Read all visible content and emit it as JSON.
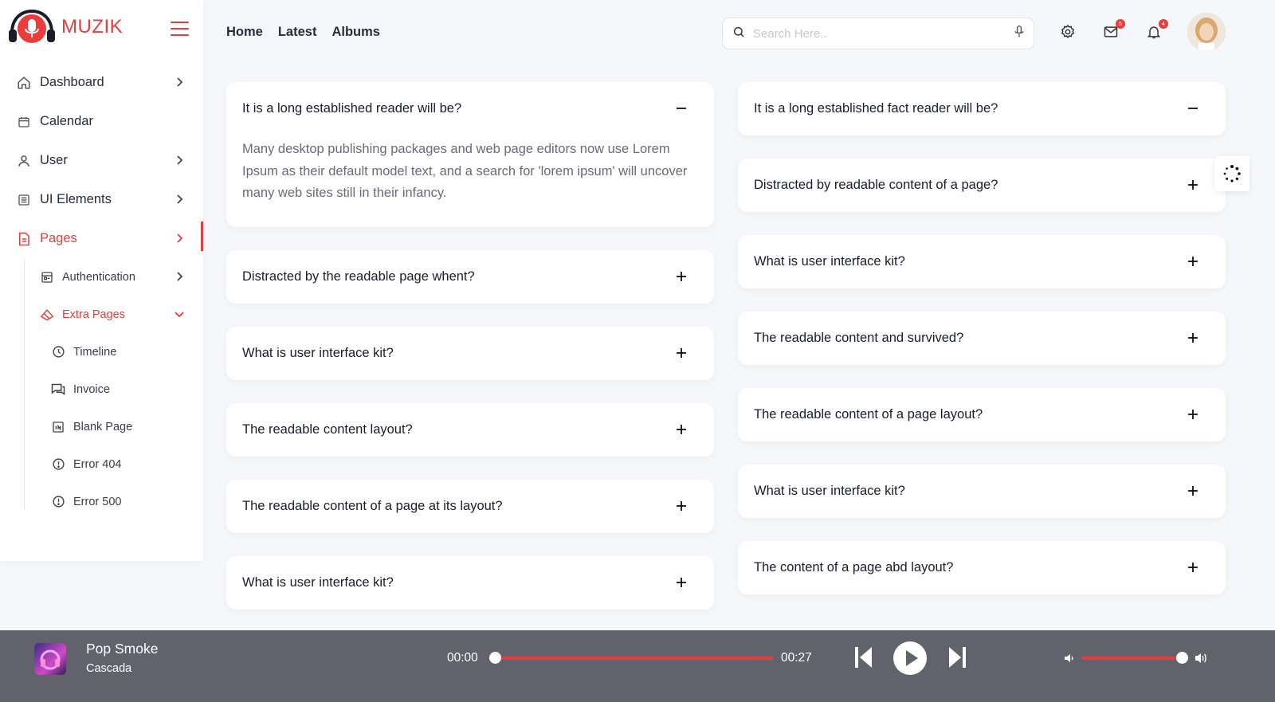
{
  "brand": {
    "name": "MUZIK",
    "accent": "#ec3b3b"
  },
  "sidebar": {
    "items": [
      {
        "label": "Dashboard",
        "icon": "home-icon",
        "chevron": true
      },
      {
        "label": "Calendar",
        "icon": "calendar-icon",
        "chevron": false
      },
      {
        "label": "User",
        "icon": "user-icon",
        "chevron": true
      },
      {
        "label": "UI Elements",
        "icon": "ui-elements-icon",
        "chevron": true
      },
      {
        "label": "Pages",
        "icon": "pages-icon",
        "chevron": true,
        "active": true
      }
    ],
    "sub_items": [
      {
        "label": "Authentication",
        "icon": "authentication-icon"
      },
      {
        "label": "Extra Pages",
        "icon": "extra-pages-icon",
        "active": true
      }
    ],
    "extra_pages": [
      {
        "label": "Timeline",
        "icon": "clock-icon"
      },
      {
        "label": "Invoice",
        "icon": "chat-icon"
      },
      {
        "label": "Blank Page",
        "icon": "blank-page-icon"
      },
      {
        "label": "Error 404",
        "icon": "alert-circle-icon"
      },
      {
        "label": "Error 500",
        "icon": "alert-circle-icon"
      }
    ]
  },
  "header": {
    "nav": [
      "Home",
      "Latest",
      "Albums"
    ],
    "search_placeholder": "Search Here..",
    "mail_badge": "5",
    "notification_badge": "4"
  },
  "faq": {
    "left": [
      {
        "question": "It is a long established reader will be?",
        "expanded": true,
        "answer": "Many desktop publishing packages and web page editors now use Lorem Ipsum as their default model text, and a search for 'lorem ipsum' will uncover many web sites still in their infancy."
      },
      {
        "question": "Distracted by the readable page whent?",
        "expanded": false
      },
      {
        "question": "What is user interface kit?",
        "expanded": false
      },
      {
        "question": "The readable content layout?",
        "expanded": false
      },
      {
        "question": "The readable content of a page at its layout?",
        "expanded": false
      },
      {
        "question": "What is user interface kit?",
        "expanded": false
      }
    ],
    "right": [
      {
        "question": "It is a long established fact reader will be?",
        "expanded": true
      },
      {
        "question": "Distracted by readable content of a page?",
        "expanded": false
      },
      {
        "question": "What is user interface kit?",
        "expanded": false
      },
      {
        "question": "The readable content and survived?",
        "expanded": false
      },
      {
        "question": "The readable content of a page layout?",
        "expanded": false
      },
      {
        "question": "What is user interface kit?",
        "expanded": false
      },
      {
        "question": "The content of a page abd layout?",
        "expanded": false
      }
    ]
  },
  "player": {
    "title": "Pop Smoke",
    "artist": "Cascada",
    "current_time": "00:00",
    "total_time": "00:27",
    "progress": 0,
    "volume": 0.95
  }
}
